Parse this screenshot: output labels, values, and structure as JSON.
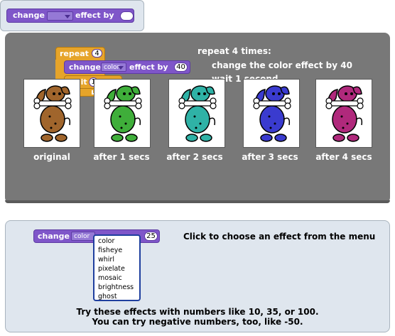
{
  "header": {
    "change_label": "change",
    "effect_by_label": "effect by"
  },
  "example": {
    "repeat_label": "repeat",
    "repeat_count": "4",
    "change_label": "change",
    "effect_value": "color",
    "effect_by_label": "effect by",
    "amount": "40",
    "wait_label": "wait",
    "wait_value": "1",
    "secs_label": "secs",
    "desc_line1": "repeat 4 times:",
    "desc_line2": "change the color effect by 40",
    "desc_line3": "wait 1 second",
    "frames": [
      {
        "caption": "original",
        "color": "#a0652c"
      },
      {
        "caption": "after 1 secs",
        "color": "#3fae3a"
      },
      {
        "caption": "after 2 secs",
        "color": "#2fb2a6"
      },
      {
        "caption": "after 3 secs",
        "color": "#3a3bcf"
      },
      {
        "caption": "after 4 secs",
        "color": "#b0297c"
      }
    ]
  },
  "chooser": {
    "change_label": "change",
    "effect_value": "color",
    "amount": "25",
    "instruction": "Click to choose an effect from the menu",
    "menu_items": [
      "color",
      "fisheye",
      "whirl",
      "pixelate",
      "mosaic",
      "brightness",
      "ghost"
    ],
    "tip_line1": "Try these effects with numbers like 10, 35, or 100.",
    "tip_line2": "You can try negative numbers, too, like -50."
  }
}
